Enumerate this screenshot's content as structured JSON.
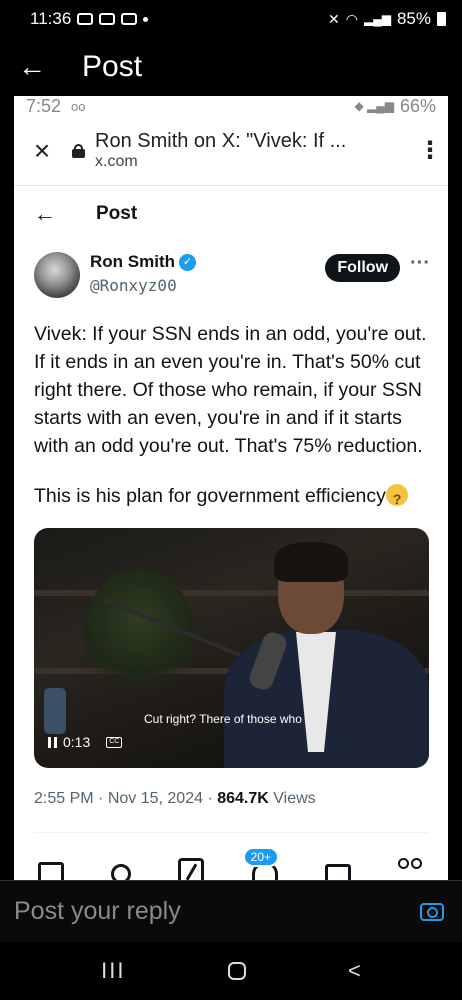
{
  "status_bar": {
    "time": "11:36",
    "battery": "85%"
  },
  "app_bar": {
    "back": "←",
    "title": "Post"
  },
  "inner_status": {
    "time": "7:52",
    "battery": "66%"
  },
  "browser": {
    "close": "×",
    "page_title": "Ron Smith on X: \"Vivek: If ...",
    "url": "x.com",
    "menu": "⋮"
  },
  "x_header": {
    "back": "←",
    "title": "Post"
  },
  "author": {
    "name": "Ron Smith",
    "handle": "@Ronxyz00",
    "follow_label": "Follow",
    "more": "···"
  },
  "tweet": {
    "paragraph1": "Vivek: If your SSN ends in an odd, you're out. If it ends in an even you're in. That's 50% cut right there. Of those who remain, if your SSN starts with an even, you're in and if it starts with an odd you're out. That's 75% reduction.",
    "paragraph2": "This is his plan for government efficiency",
    "emoji_name": "thinking-face"
  },
  "video": {
    "caption": "Cut right? There of those who",
    "time": "0:13",
    "cc": "CC"
  },
  "meta": {
    "time": "2:55 PM",
    "date": "Nov 15, 2024",
    "views_count": "864.7K",
    "views_label": "Views"
  },
  "bottom_nav": {
    "notification_badge": "20+"
  },
  "reply": {
    "placeholder": "Post your reply"
  },
  "system_nav": {
    "recents": "III",
    "back": "<"
  }
}
